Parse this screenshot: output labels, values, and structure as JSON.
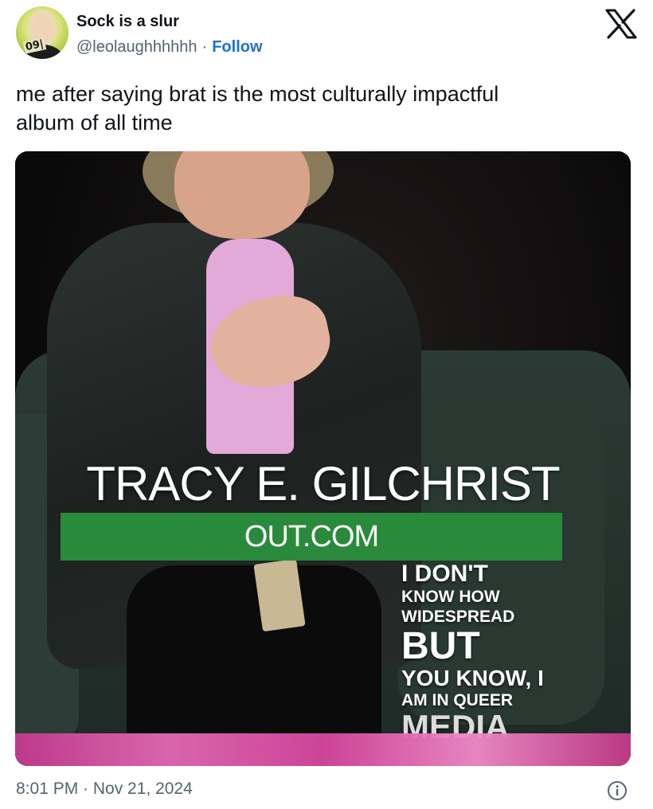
{
  "author": {
    "name": "Sock is a slur",
    "handle": "@leolaughhhhhh",
    "separator": "·",
    "follow_label": "Follow",
    "avatar_sign_text": "09|"
  },
  "tweet": {
    "text_line1": "me after saying brat is the most culturally impactful",
    "text_line2": "album of all time"
  },
  "media": {
    "lower_third_name": "TRACY E. GILCHRIST",
    "lower_third_outlet": "OUT.COM",
    "caption_lines": [
      "I DON'T",
      "KNOW HOW",
      "WIDESPREAD",
      "BUT",
      "YOU KNOW, I",
      "AM IN QUEER",
      "MEDIA"
    ],
    "bar_color": "#2a8a3b",
    "glitter_color": "#d7479e"
  },
  "footer": {
    "timestamp": "8:01 PM · Nov 21, 2024",
    "info_icon": "info-icon"
  },
  "icons": {
    "platform_logo": "x-logo-icon"
  },
  "colors": {
    "follow": "#1d6fd6",
    "secondary_text": "#536471"
  }
}
